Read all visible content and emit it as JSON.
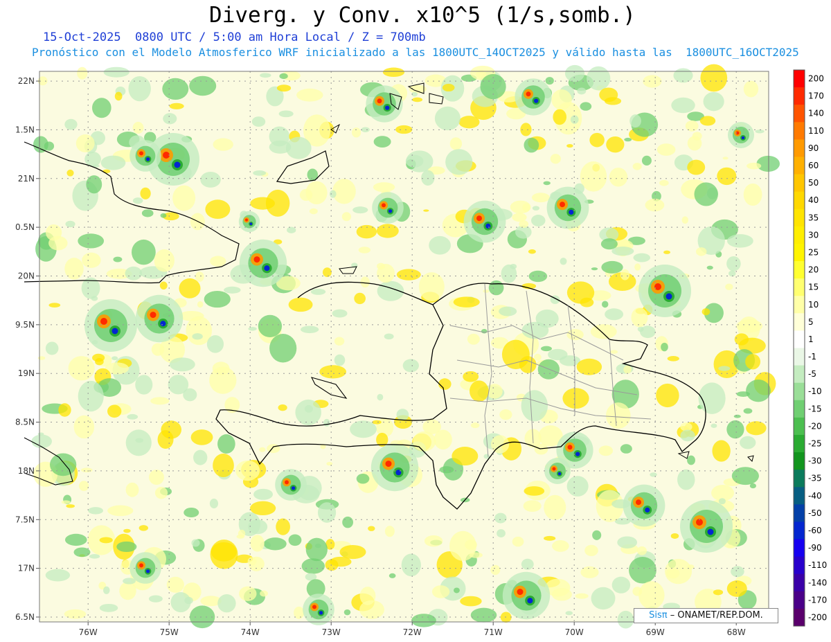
{
  "title": "Diverg. y Conv. x10^5 (1/s,somb.)",
  "subtitle_date": "15-Oct-2025  0800 UTC / 5:00 am Hora Local / Z = 700mb",
  "subtitle_model": "Pronóstico con el Modelo Atmosferico WRF inicializado a las 1800UTC_14OCT2025 y válido hasta las  1800UTC_16OCT2025",
  "credit": {
    "logo": "Sisπ",
    "text": "– ONAMET/REP.DOM."
  },
  "lat_labels": [
    "22N",
    "1.5N",
    "21N",
    "0.5N",
    "20N",
    "9.5N",
    "19N",
    "8.5N",
    "18N",
    "7.5N",
    "17N",
    "6.5N"
  ],
  "lat_values": [
    22,
    21.5,
    21,
    20.5,
    20,
    19.5,
    19,
    18.5,
    18,
    17.5,
    17,
    16.5
  ],
  "lon_labels": [
    "76W",
    "75W",
    "74W",
    "73W",
    "72W",
    "71W",
    "70W",
    "69W",
    "68W"
  ],
  "lon_values": [
    -76,
    -75,
    -74,
    -73,
    -72,
    -71,
    -70,
    -69,
    -68
  ],
  "colorbar": {
    "labels": [
      "200",
      "170",
      "140",
      "110",
      "90",
      "60",
      "50",
      "40",
      "35",
      "30",
      "25",
      "20",
      "15",
      "10",
      "5",
      "1",
      "-1",
      "-5",
      "-10",
      "-15",
      "-20",
      "-25",
      "-30",
      "-35",
      "-40",
      "-50",
      "-60",
      "-90",
      "-110",
      "-140",
      "-170",
      "-200"
    ],
    "colors": [
      "#ff0000",
      "#ff2a00",
      "#ff5400",
      "#ff7a00",
      "#ff9a00",
      "#ffb000",
      "#ffc600",
      "#ffd800",
      "#ffe400",
      "#ffee00",
      "#fff400",
      "#ffff30",
      "#ffff70",
      "#ffffa8",
      "#ffffd8",
      "#ffffff",
      "#eaf7e6",
      "#c4ecc0",
      "#9ade98",
      "#70cf72",
      "#4cbf50",
      "#2aab32",
      "#12951e",
      "#0b7b5c",
      "#075e82",
      "#0440a8",
      "#0426d0",
      "#1600f0",
      "#2800cc",
      "#3a00a8",
      "#4a0088",
      "#5a006c"
    ]
  },
  "field_palette": {
    "conv_light": "#c4ecc0",
    "conv_mid": "#70cf72",
    "conv_strong": "#2aab32",
    "conv_core": "#0426d0",
    "div_light": "#ffffa8",
    "div_mid": "#ffe400",
    "div_strong": "#ff9a00",
    "div_core": "#ff2a00"
  },
  "coast_color": "#000000",
  "province_color": "#9a9a9a"
}
